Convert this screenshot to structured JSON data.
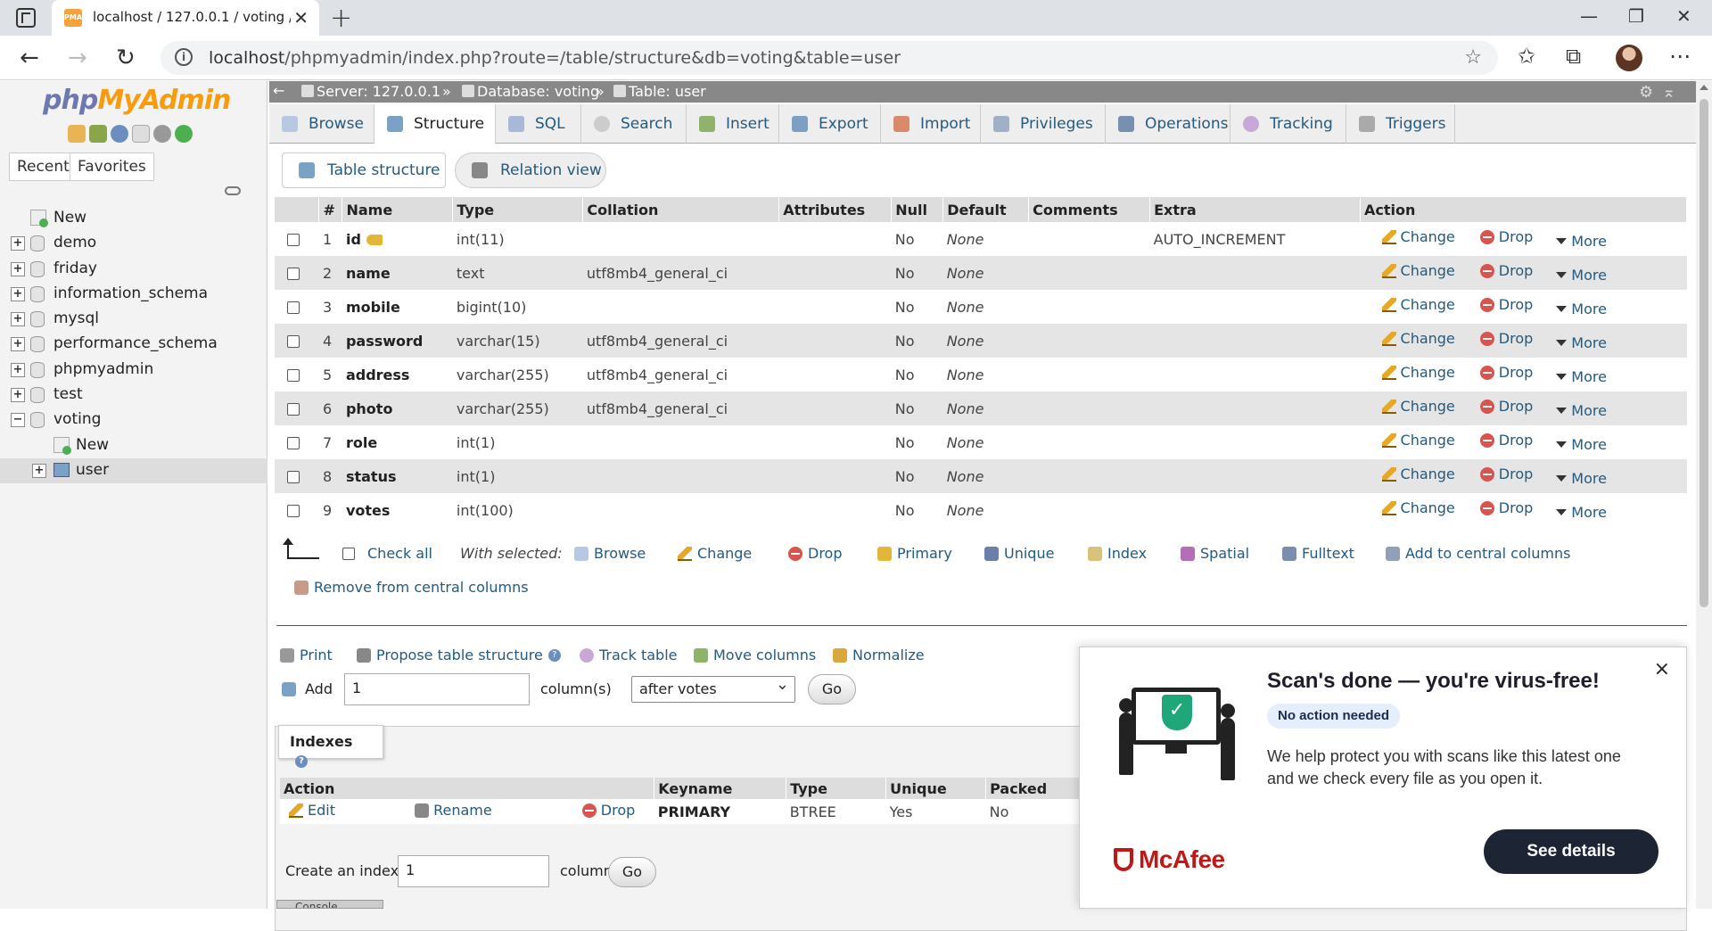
{
  "browser": {
    "tab_title": "localhost / 127.0.0.1 / voting / user",
    "favicon_text": "PMA",
    "url_host": "localhost",
    "url_path": "/phpmyadmin/index.php?route=/table/structure&db=voting&table=user"
  },
  "sidebar": {
    "logo_part1": "php",
    "logo_part2": "MyAdmin",
    "recent_label": "Recent",
    "favorites_label": "Favorites",
    "tree": [
      {
        "label": "New",
        "type": "new"
      },
      {
        "label": "demo",
        "type": "db"
      },
      {
        "label": "friday",
        "type": "db"
      },
      {
        "label": "information_schema",
        "type": "db"
      },
      {
        "label": "mysql",
        "type": "db"
      },
      {
        "label": "performance_schema",
        "type": "db"
      },
      {
        "label": "phpmyadmin",
        "type": "db"
      },
      {
        "label": "test",
        "type": "db"
      },
      {
        "label": "voting",
        "type": "db-open"
      },
      {
        "label": "New",
        "type": "child-new"
      },
      {
        "label": "user",
        "type": "child-table"
      }
    ]
  },
  "breadcrumb": {
    "server": "Server: 127.0.0.1",
    "database": "Database: voting",
    "table": "Table: user",
    "separator": "»"
  },
  "menu_tabs": [
    "Browse",
    "Structure",
    "SQL",
    "Search",
    "Insert",
    "Export",
    "Import",
    "Privileges",
    "Operations",
    "Tracking",
    "Triggers"
  ],
  "active_tab": "Structure",
  "sub_tabs": {
    "table_structure": "Table structure",
    "relation_view": "Relation view"
  },
  "structure": {
    "headers": [
      "#",
      "Name",
      "Type",
      "Collation",
      "Attributes",
      "Null",
      "Default",
      "Comments",
      "Extra",
      "Action"
    ],
    "rows": [
      {
        "num": "1",
        "name": "id",
        "type": "int(11)",
        "collation": "",
        "attributes": "",
        "null": "No",
        "default": "None",
        "comments": "",
        "extra": "AUTO_INCREMENT",
        "primary": true
      },
      {
        "num": "2",
        "name": "name",
        "type": "text",
        "collation": "utf8mb4_general_ci",
        "attributes": "",
        "null": "No",
        "default": "None",
        "comments": "",
        "extra": ""
      },
      {
        "num": "3",
        "name": "mobile",
        "type": "bigint(10)",
        "collation": "",
        "attributes": "",
        "null": "No",
        "default": "None",
        "comments": "",
        "extra": ""
      },
      {
        "num": "4",
        "name": "password",
        "type": "varchar(15)",
        "collation": "utf8mb4_general_ci",
        "attributes": "",
        "null": "No",
        "default": "None",
        "comments": "",
        "extra": ""
      },
      {
        "num": "5",
        "name": "address",
        "type": "varchar(255)",
        "collation": "utf8mb4_general_ci",
        "attributes": "",
        "null": "No",
        "default": "None",
        "comments": "",
        "extra": ""
      },
      {
        "num": "6",
        "name": "photo",
        "type": "varchar(255)",
        "collation": "utf8mb4_general_ci",
        "attributes": "",
        "null": "No",
        "default": "None",
        "comments": "",
        "extra": ""
      },
      {
        "num": "7",
        "name": "role",
        "type": "int(1)",
        "collation": "",
        "attributes": "",
        "null": "No",
        "default": "None",
        "comments": "",
        "extra": ""
      },
      {
        "num": "8",
        "name": "status",
        "type": "int(1)",
        "collation": "",
        "attributes": "",
        "null": "No",
        "default": "None",
        "comments": "",
        "extra": ""
      },
      {
        "num": "9",
        "name": "votes",
        "type": "int(100)",
        "collation": "",
        "attributes": "",
        "null": "No",
        "default": "None",
        "comments": "",
        "extra": ""
      }
    ],
    "row_actions": {
      "change": "Change",
      "drop": "Drop",
      "more": "More"
    }
  },
  "with_selected": {
    "check_all": "Check all",
    "label": "With selected:",
    "actions": [
      "Browse",
      "Change",
      "Drop",
      "Primary",
      "Unique",
      "Index",
      "Spatial",
      "Fulltext",
      "Add to central columns"
    ],
    "remove_central": "Remove from central columns"
  },
  "tools": {
    "print": "Print",
    "propose": "Propose table structure",
    "track": "Track table",
    "move": "Move columns",
    "normalize": "Normalize"
  },
  "add_columns": {
    "label": "Add",
    "value": "1",
    "unit": "column(s)",
    "position": "after votes",
    "go": "Go"
  },
  "indexes": {
    "legend": "Indexes",
    "headers": [
      "Action",
      "Keyname",
      "Type",
      "Unique",
      "Packed"
    ],
    "row": {
      "edit": "Edit",
      "rename": "Rename",
      "drop": "Drop",
      "keyname": "PRIMARY",
      "type": "BTREE",
      "unique": "Yes",
      "packed": "No"
    },
    "create_label": "Create an index on",
    "create_value": "1",
    "create_unit": "columns",
    "go": "Go"
  },
  "console_label": "Console",
  "popup": {
    "title": "Scan's done — you're virus-free!",
    "badge": "No action needed",
    "body": "We help protect you with scans like this latest one and we check every file as you open it.",
    "brand": "McAfee",
    "button": "See details",
    "close": "×",
    "brand_color": "#c01818"
  },
  "colors": {
    "link": "#235a81",
    "accent_orange": "#f89c0e",
    "pma_blue": "#6c78af"
  }
}
